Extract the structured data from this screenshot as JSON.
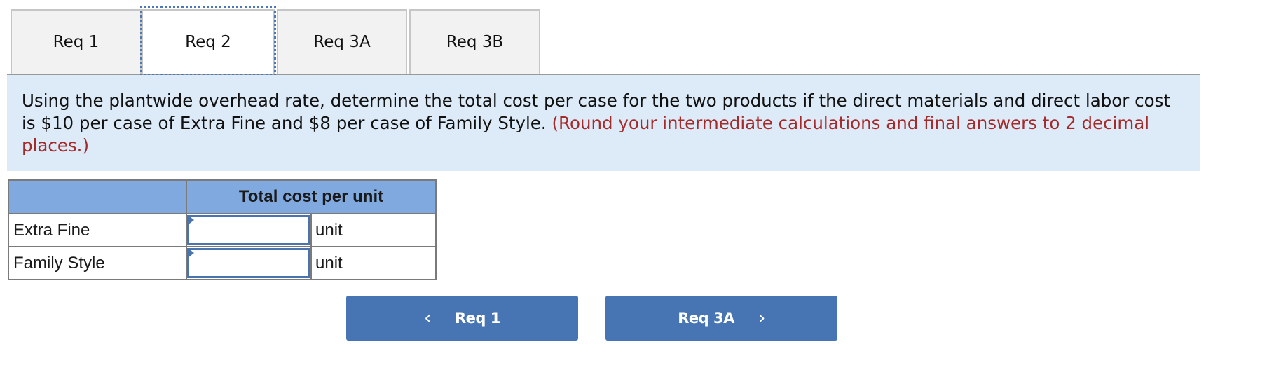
{
  "tabs": [
    {
      "label": "Req 1",
      "active": false
    },
    {
      "label": "Req 2",
      "active": true
    },
    {
      "label": "Req 3A",
      "active": false
    },
    {
      "label": "Req 3B",
      "active": false
    }
  ],
  "instructions": {
    "text": "Using the plantwide overhead rate, determine the total cost per case for the two products if the direct materials and direct labor cost is $10 per case of Extra Fine and $8 per case of Family Style.",
    "note": "(Round your intermediate calculations and final answers to 2 decimal places.)"
  },
  "table": {
    "header": {
      "label_col": "",
      "value_col": "Total cost per unit"
    },
    "rows": [
      {
        "label": "Extra Fine",
        "value": "",
        "unit": "unit"
      },
      {
        "label": "Family Style",
        "value": "",
        "unit": "unit"
      }
    ]
  },
  "navigation": {
    "prev": {
      "label": "Req 1",
      "icon": "chevron-left-icon",
      "glyph": "‹"
    },
    "next": {
      "label": "Req 3A",
      "icon": "chevron-right-icon",
      "glyph": "›"
    }
  },
  "colors": {
    "accent": "#4775b3",
    "instruction_bg": "#ddebf8",
    "table_header_bg": "#80aadf",
    "note_text": "#a52a2a"
  }
}
